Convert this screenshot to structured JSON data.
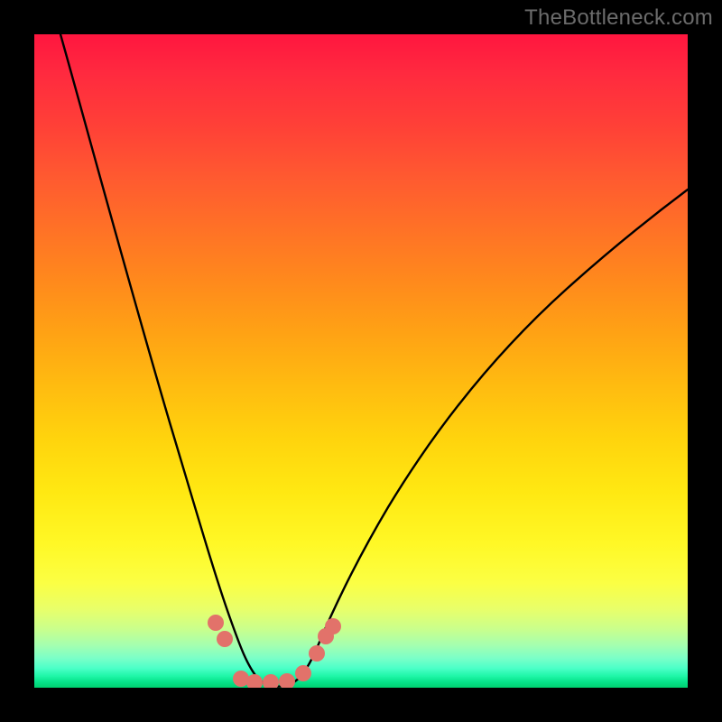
{
  "watermark": "TheBottleneck.com",
  "chart_data": {
    "type": "line",
    "title": "",
    "xlabel": "",
    "ylabel": "",
    "xlim": [
      0,
      100
    ],
    "ylim": [
      0,
      100
    ],
    "grid": false,
    "legend": false,
    "series": [
      {
        "name": "bottleneck-curve",
        "color": "#000000",
        "x": [
          4,
          8,
          12,
          16,
          20,
          24,
          26,
          28,
          30,
          31,
          32,
          34,
          36,
          38,
          40,
          42,
          44,
          48,
          54,
          62,
          72,
          84,
          100
        ],
        "y": [
          100,
          86,
          72,
          58,
          44,
          30,
          22,
          14,
          7,
          3,
          1,
          0,
          0,
          0,
          1,
          3,
          6,
          12,
          20,
          30,
          42,
          56,
          72
        ]
      }
    ],
    "markers": {
      "name": "highlight-dots",
      "color": "#e2726a",
      "points": [
        {
          "x": 27.5,
          "y": 9.5
        },
        {
          "x": 29.0,
          "y": 7.0
        },
        {
          "x": 31.5,
          "y": 1.0
        },
        {
          "x": 33.5,
          "y": 0.5
        },
        {
          "x": 36.0,
          "y": 0.5
        },
        {
          "x": 38.5,
          "y": 0.7
        },
        {
          "x": 41.0,
          "y": 2.0
        },
        {
          "x": 43.0,
          "y": 5.0
        },
        {
          "x": 44.5,
          "y": 7.5
        },
        {
          "x": 45.5,
          "y": 9.0
        }
      ]
    },
    "background_gradient": {
      "top": "#ff163f",
      "mid": "#ffe812",
      "bottom": "#00d070"
    }
  }
}
